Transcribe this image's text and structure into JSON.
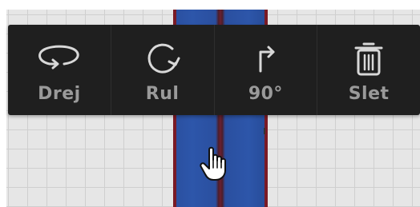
{
  "toolbar": {
    "items": [
      {
        "label": "Drej",
        "icon": "rotate-icon"
      },
      {
        "label": "Rul",
        "icon": "roll-icon"
      },
      {
        "label": "90°",
        "icon": "turn-90-icon"
      },
      {
        "label": "Slet",
        "icon": "trash-icon"
      }
    ]
  },
  "colors": {
    "toolbar_bg": "#1f1f1f",
    "label": "#9a9a9a",
    "icon": "#d8d8d8",
    "piece_blue": "#2a4f9f",
    "piece_edge": "#7a1a25",
    "grid_bg": "#e6e6e6"
  }
}
